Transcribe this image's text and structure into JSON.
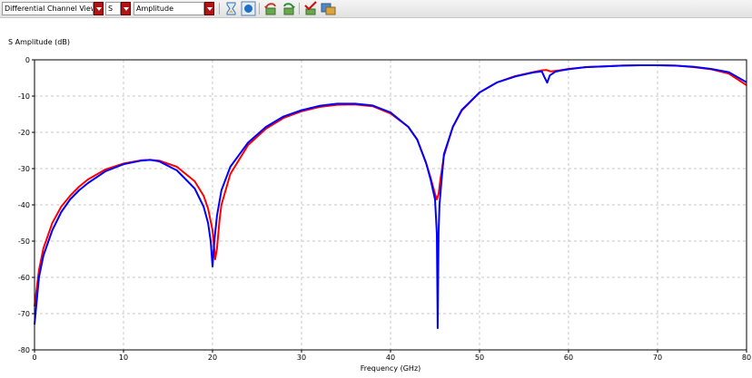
{
  "toolbar": {
    "view_select": "Differential Channel View",
    "param_select": "S",
    "format_select": "Amplitude",
    "icons": [
      "hourglass-icon",
      "record-icon",
      "undo-icon",
      "redo-icon",
      "checkmark-icon",
      "export-icon"
    ]
  },
  "chart_data": {
    "type": "line",
    "title": "S Amplitude (dB)",
    "xlabel": "Frequency (GHz)",
    "ylabel": "",
    "xlim": [
      0,
      80
    ],
    "ylim": [
      -80,
      0
    ],
    "xticks": [
      "0",
      "10",
      "20",
      "30",
      "40",
      "50",
      "60",
      "70",
      "80"
    ],
    "yticks": [
      "0",
      "-10",
      "-20",
      "-30",
      "-40",
      "-50",
      "-60",
      "-70",
      "-80"
    ],
    "grid": true,
    "legend": "none",
    "series": [
      {
        "color": "#ff0000",
        "x": [
          0,
          0.5,
          1,
          2,
          3,
          4,
          5,
          6,
          8,
          10,
          12,
          13,
          14,
          16,
          18,
          19,
          19.5,
          20,
          20.3,
          20.5,
          20.8,
          21,
          22,
          24,
          26,
          28,
          30,
          32,
          34,
          36,
          38,
          40,
          42,
          43,
          44,
          44.5,
          45,
          45.2,
          45.4,
          45.6,
          46,
          47,
          48,
          50,
          52,
          54,
          56,
          57,
          57.5,
          58,
          59,
          60,
          62,
          64,
          66,
          68,
          70,
          72,
          74,
          76,
          78,
          80
        ],
        "y": [
          -68,
          -58,
          -52,
          -45,
          -40.5,
          -37.5,
          -35,
          -33,
          -30.2,
          -28.6,
          -27.7,
          -27.6,
          -27.8,
          -29.5,
          -33.5,
          -37.5,
          -41,
          -47,
          -55,
          -52,
          -44,
          -40,
          -31.5,
          -23.5,
          -19,
          -16,
          -14.2,
          -13,
          -12.4,
          -12.3,
          -12.8,
          -14.8,
          -18.5,
          -22,
          -28.5,
          -32.5,
          -37,
          -38.5,
          -37,
          -33,
          -26.5,
          -18.5,
          -14,
          -9,
          -6.2,
          -4.5,
          -3.4,
          -2.9,
          -2.8,
          -3.2,
          -2.9,
          -2.5,
          -2,
          -1.8,
          -1.6,
          -1.5,
          -1.5,
          -1.6,
          -2,
          -2.6,
          -3.8,
          -7
        ]
      },
      {
        "color": "#0000ff",
        "x": [
          0,
          0.5,
          1,
          2,
          3,
          4,
          5,
          6,
          8,
          10,
          12,
          13,
          14,
          16,
          18,
          19,
          19.5,
          19.8,
          20,
          20.2,
          20.5,
          21,
          22,
          24,
          26,
          28,
          30,
          32,
          34,
          36,
          38,
          40,
          42,
          43,
          44,
          44.5,
          45,
          45.2,
          45.3,
          45.4,
          45.5,
          45.7,
          46,
          47,
          48,
          50,
          52,
          54,
          56,
          57,
          57.3,
          57.6,
          57.9,
          58.5,
          59,
          60,
          62,
          64,
          66,
          68,
          70,
          72,
          74,
          76,
          78,
          80
        ],
        "y": [
          -73,
          -60,
          -54,
          -47,
          -42,
          -38.5,
          -36,
          -34,
          -30.7,
          -28.8,
          -27.8,
          -27.6,
          -28,
          -30.5,
          -35.5,
          -40.5,
          -45,
          -50,
          -57,
          -50,
          -43,
          -36,
          -29.5,
          -22.8,
          -18.5,
          -15.6,
          -13.9,
          -12.7,
          -12.1,
          -12.1,
          -12.6,
          -14.5,
          -18.5,
          -22,
          -28.5,
          -33,
          -38.5,
          -48,
          -74,
          -48,
          -40,
          -34,
          -26,
          -18.5,
          -13.8,
          -9,
          -6.2,
          -4.6,
          -3.5,
          -3.2,
          -4.8,
          -6.3,
          -4.3,
          -3.3,
          -3,
          -2.6,
          -2,
          -1.8,
          -1.6,
          -1.5,
          -1.5,
          -1.6,
          -1.9,
          -2.5,
          -3.4,
          -6.2
        ]
      }
    ]
  }
}
